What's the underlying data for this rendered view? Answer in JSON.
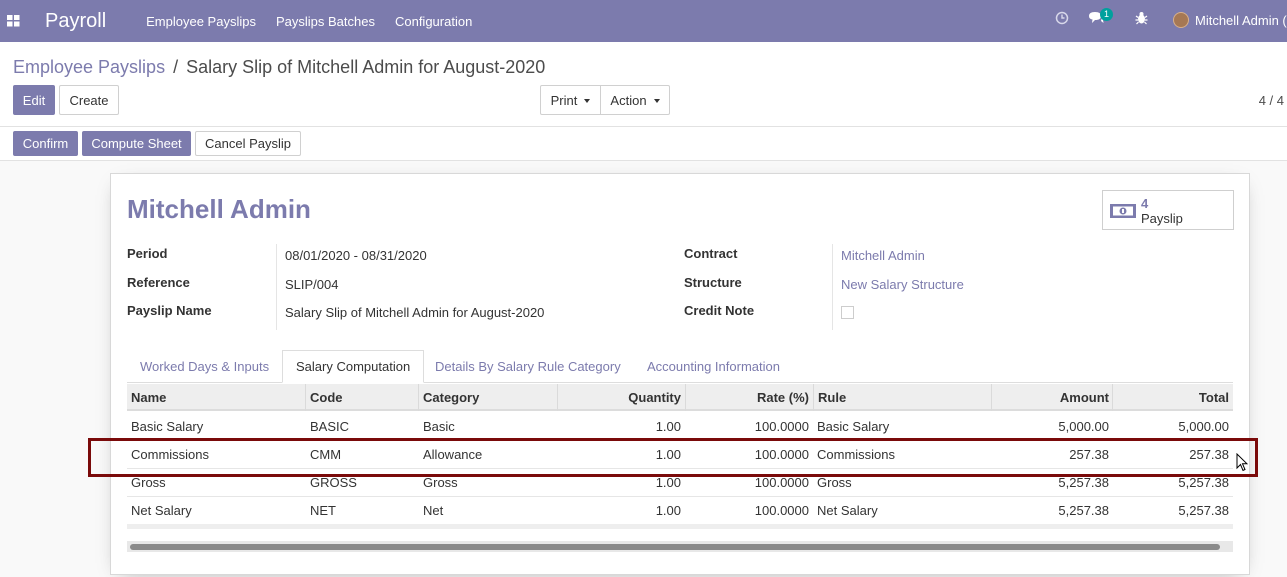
{
  "navbar": {
    "brand": "Payroll",
    "menu": [
      "Employee Payslips",
      "Payslips Batches",
      "Configuration"
    ],
    "chat_badge": "1",
    "user_name": "Mitchell Admin ("
  },
  "breadcrumb": {
    "parent": "Employee Payslips",
    "separator": "/",
    "current": "Salary Slip of Mitchell Admin for August-2020"
  },
  "control": {
    "edit": "Edit",
    "create": "Create",
    "print": "Print",
    "action": "Action",
    "pager": "4 / 4"
  },
  "statusbar": {
    "confirm": "Confirm",
    "compute": "Compute Sheet",
    "cancel": "Cancel Payslip"
  },
  "form": {
    "employee": "Mitchell Admin",
    "smart_button": {
      "count": "4",
      "label": "Payslip"
    },
    "left_fields": [
      {
        "label": "Period",
        "value": "08/01/2020 - 08/31/2020"
      },
      {
        "label": "Reference",
        "value": "SLIP/004"
      },
      {
        "label": "Payslip Name",
        "value": "Salary Slip of Mitchell Admin for August-2020"
      }
    ],
    "right_fields": [
      {
        "label": "Contract",
        "value": "Mitchell Admin"
      },
      {
        "label": "Structure",
        "value": "New Salary Structure"
      },
      {
        "label": "Credit Note",
        "value": ""
      }
    ]
  },
  "tabs": [
    "Worked Days & Inputs",
    "Salary Computation",
    "Details By Salary Rule Category",
    "Accounting Information"
  ],
  "table": {
    "headers": [
      "Name",
      "Code",
      "Category",
      "Quantity",
      "Rate (%)",
      "Rule",
      "Amount",
      "Total"
    ],
    "rows": [
      [
        "Basic Salary",
        "BASIC",
        "Basic",
        "1.00",
        "100.0000",
        "Basic Salary",
        "5,000.00",
        "5,000.00"
      ],
      [
        "Commissions",
        "CMM",
        "Allowance",
        "1.00",
        "100.0000",
        "Commissions",
        "257.38",
        "257.38"
      ],
      [
        "Gross",
        "GROSS",
        "Gross",
        "1.00",
        "100.0000",
        "Gross",
        "5,257.38",
        "5,257.38"
      ],
      [
        "Net Salary",
        "NET",
        "Net",
        "1.00",
        "100.0000",
        "Net Salary",
        "5,257.38",
        "5,257.38"
      ]
    ]
  },
  "colors": {
    "brand": "#7c7bad",
    "highlight": "#7a0a0a",
    "teal_badge": "#00a09d"
  }
}
